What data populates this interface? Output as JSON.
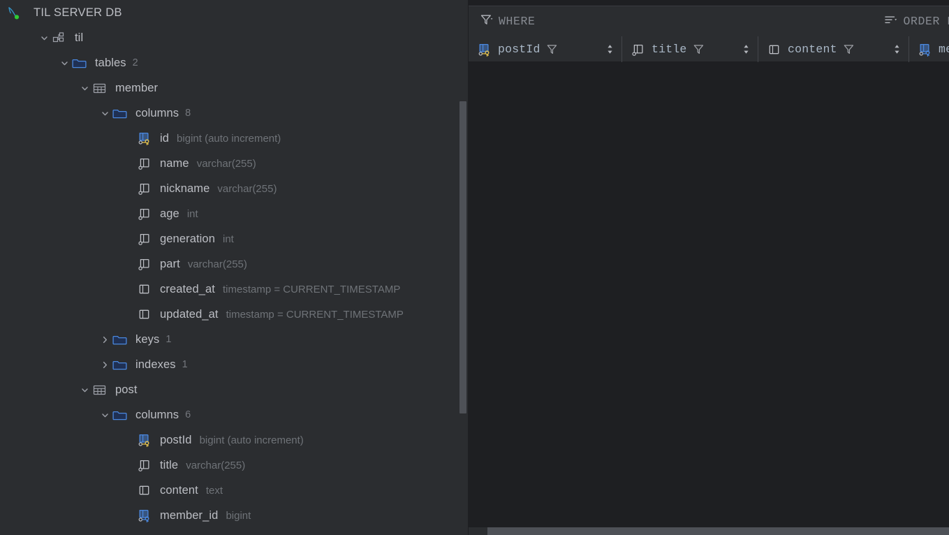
{
  "connection": {
    "title": "TIL SERVER DB",
    "icon": "mysql-dolphin-icon",
    "status_color": "#2ecc32"
  },
  "schema": {
    "label": "til",
    "icon": "schema-icon"
  },
  "tables_folder": {
    "label": "tables",
    "count": "2",
    "icon": "folder-icon"
  },
  "tables": [
    {
      "name": "member",
      "columns_folder": {
        "label": "columns",
        "count": "8"
      },
      "columns": [
        {
          "name": "id",
          "type": "bigint (auto increment)",
          "icon": "column-primary-key-icon"
        },
        {
          "name": "name",
          "type": "varchar(255)",
          "icon": "column-nullable-icon"
        },
        {
          "name": "nickname",
          "type": "varchar(255)",
          "icon": "column-nullable-icon"
        },
        {
          "name": "age",
          "type": "int",
          "icon": "column-nullable-icon"
        },
        {
          "name": "generation",
          "type": "int",
          "icon": "column-nullable-icon"
        },
        {
          "name": "part",
          "type": "varchar(255)",
          "icon": "column-nullable-icon"
        },
        {
          "name": "created_at",
          "type": "timestamp = CURRENT_TIMESTAMP",
          "icon": "column-icon"
        },
        {
          "name": "updated_at",
          "type": "timestamp = CURRENT_TIMESTAMP",
          "icon": "column-icon"
        }
      ],
      "keys_folder": {
        "label": "keys",
        "count": "1"
      },
      "indexes_folder": {
        "label": "indexes",
        "count": "1"
      }
    },
    {
      "name": "post",
      "columns_folder": {
        "label": "columns",
        "count": "6"
      },
      "columns": [
        {
          "name": "postId",
          "type": "bigint (auto increment)",
          "icon": "column-primary-key-icon"
        },
        {
          "name": "title",
          "type": "varchar(255)",
          "icon": "column-nullable-icon"
        },
        {
          "name": "content",
          "type": "text",
          "icon": "column-icon"
        },
        {
          "name": "member_id",
          "type": "bigint",
          "icon": "column-foreign-key-icon"
        }
      ]
    }
  ],
  "data_grid": {
    "filter_bar": {
      "where_label": "WHERE",
      "where_icon": "filter-funnel-icon",
      "order_by_label": "ORDER B",
      "order_by_icon": "sort-lines-icon"
    },
    "columns": [
      {
        "name": "postId",
        "icon": "column-primary-key-icon",
        "filter_icon": "funnel-icon",
        "sort_icon": "sort-updown-icon"
      },
      {
        "name": "title",
        "icon": "column-nullable-icon",
        "filter_icon": "funnel-icon",
        "sort_icon": "sort-updown-icon"
      },
      {
        "name": "content",
        "icon": "column-icon",
        "filter_icon": "funnel-icon",
        "sort_icon": "sort-updown-icon"
      },
      {
        "name": "memb",
        "icon": "column-foreign-key-icon",
        "filter_icon": "funnel-icon",
        "sort_icon": "sort-updown-icon"
      }
    ],
    "rows": []
  },
  "colors": {
    "sidebar_bg": "#2b2d30",
    "grid_bg": "#1e1f22",
    "folder_blue": "#4a88e0",
    "key_gold": "#dfbf4f",
    "key_blue": "#4a88e0",
    "text": "#bcbec4",
    "text_dim": "#6f7378",
    "header_text": "#a9b7c6",
    "scrollbar": "#4e5157"
  }
}
